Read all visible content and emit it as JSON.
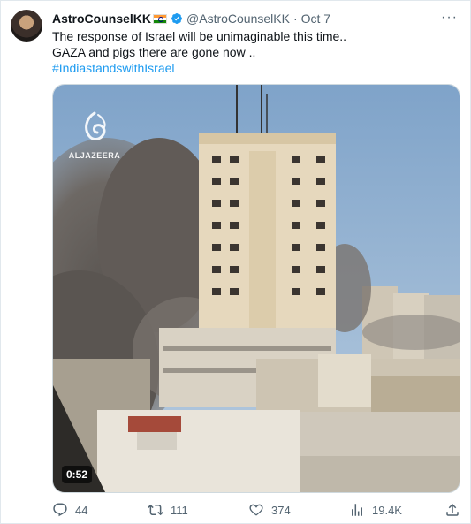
{
  "tweet": {
    "author_name": "AstroCounselKK",
    "handle": "@AstroCounselKK",
    "separator": "·",
    "date": "Oct 7",
    "more_label": "···",
    "lines": [
      "The response of Israel will be unimaginable this time..",
      "GAZA and pigs there are gone now .."
    ],
    "hashtag": "#IndiastandswithIsrael"
  },
  "media": {
    "watermark": "ALJAZEERA",
    "duration": "0:52"
  },
  "actions": {
    "replies": "44",
    "reposts": "111",
    "likes": "374",
    "views": "19.4K"
  },
  "colors": {
    "accent": "#1d9bf0",
    "muted": "#536471",
    "text": "#0f1419"
  }
}
